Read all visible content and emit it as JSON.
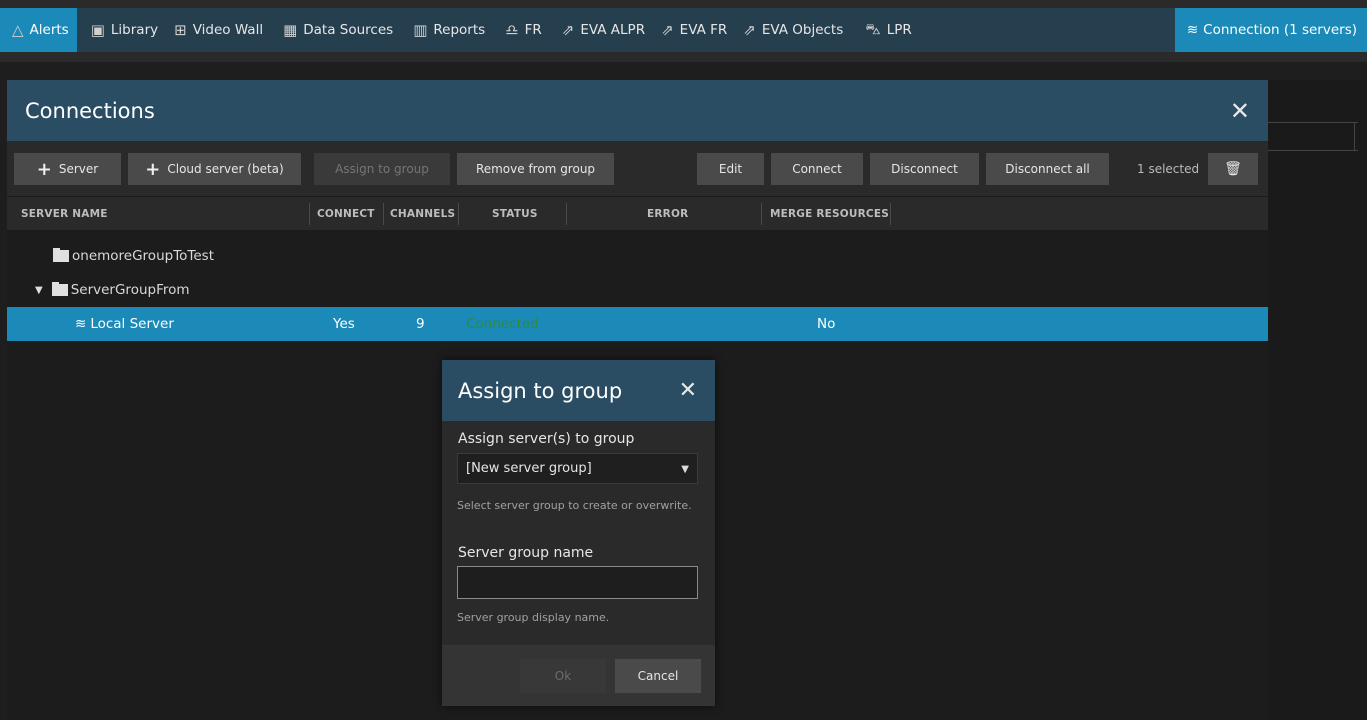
{
  "nav": {
    "items": [
      {
        "label": "Alerts",
        "icon": "bell-icon",
        "glyph": "△"
      },
      {
        "label": "Library",
        "icon": "library-icon",
        "glyph": "▣"
      },
      {
        "label": "Video Wall",
        "icon": "grid-icon",
        "glyph": "⊞"
      },
      {
        "label": "Data Sources",
        "icon": "data-sources-icon",
        "glyph": "▦"
      },
      {
        "label": "Reports",
        "icon": "bar-chart-icon",
        "glyph": "▥"
      },
      {
        "label": "FR",
        "icon": "face-icon",
        "glyph": "♎"
      },
      {
        "label": "EVA ALPR",
        "icon": "external-link-icon",
        "glyph": "⇗"
      },
      {
        "label": "EVA FR",
        "icon": "external-link-icon",
        "glyph": "⇗"
      },
      {
        "label": "EVA Objects",
        "icon": "external-link-icon",
        "glyph": "⇗"
      },
      {
        "label": "LPR",
        "icon": "car-icon",
        "glyph": "⛍"
      }
    ],
    "connection_label": "Connection (1 servers)",
    "connection_glyph": "≋"
  },
  "connections": {
    "title": "Connections",
    "close_glyph": "✕",
    "toolbar": {
      "add_server": "Server",
      "add_cloud_server": "Cloud server (beta)",
      "assign_to_group": "Assign to group",
      "remove_from_group": "Remove from group",
      "edit": "Edit",
      "connect": "Connect",
      "disconnect": "Disconnect",
      "disconnect_all": "Disconnect all",
      "selected_count": "1 selected",
      "delete_glyph": "🗑"
    },
    "columns": {
      "server_name": "SERVER NAME",
      "connect": "CONNECT",
      "channels": "CHANNELS",
      "status": "STATUS",
      "error": "ERROR",
      "merge_resources": "MERGE RESOURCES"
    },
    "rows": {
      "group1": {
        "name": "onemoreGroupToTest"
      },
      "group2": {
        "name": "ServerGroupFrom",
        "caret": "▼"
      },
      "server": {
        "name": "Local Server",
        "glyph": "≋",
        "connect": "Yes",
        "channels": "9",
        "status": "Connected",
        "merge": "No"
      }
    }
  },
  "assign": {
    "title": "Assign to group",
    "close_glyph": "✕",
    "group_label": "Assign server(s) to group",
    "group_selected": "[New server group]",
    "dropdown_glyph": "▼",
    "group_hint": "Select server group to create or overwrite.",
    "name_label": "Server group name",
    "name_value": "",
    "name_hint": "Server group display name.",
    "ok": "Ok",
    "cancel": "Cancel"
  },
  "colors": {
    "accent": "#1b8ab8",
    "header": "#2b4d64",
    "nav": "#263f4f",
    "status_connected": "#2e8a3c"
  }
}
